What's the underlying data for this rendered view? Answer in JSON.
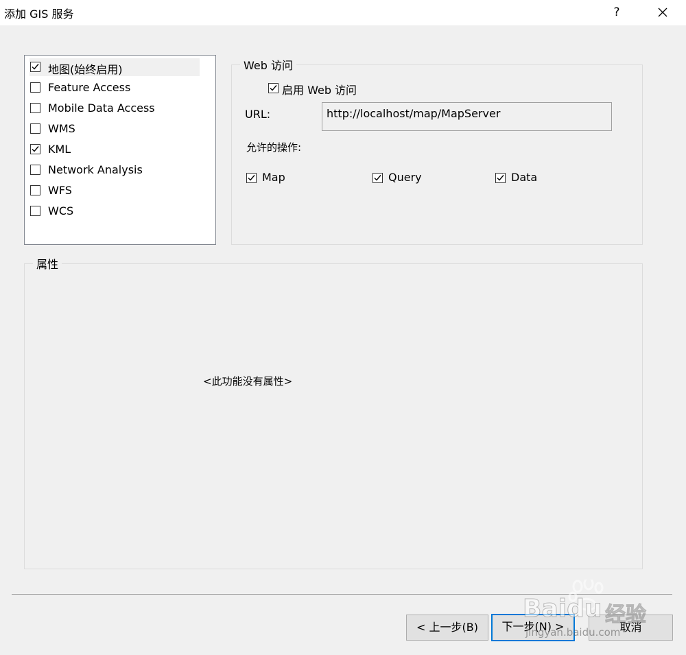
{
  "dialog": {
    "title": "添加 GIS 服务",
    "help_label": "?"
  },
  "services": [
    {
      "label": "地图(始终启用)",
      "checked": true,
      "selected": true
    },
    {
      "label": "Feature Access",
      "checked": false
    },
    {
      "label": "Mobile Data Access",
      "checked": false
    },
    {
      "label": "WMS",
      "checked": false
    },
    {
      "label": "KML",
      "checked": true
    },
    {
      "label": "Network Analysis",
      "checked": false
    },
    {
      "label": "WFS",
      "checked": false
    },
    {
      "label": "WCS",
      "checked": false
    }
  ],
  "web_access": {
    "group_title": "Web 访问",
    "enable_label": "启用 Web 访问",
    "enabled": true,
    "url_label": "URL:",
    "url_value": "http://localhost/map/MapServer",
    "operations_label": "允许的操作:",
    "operations": [
      {
        "label": "Map",
        "checked": true
      },
      {
        "label": "Query",
        "checked": true
      },
      {
        "label": "Data",
        "checked": true
      }
    ]
  },
  "properties": {
    "group_title": "属性",
    "empty_text": "<此功能没有属性>"
  },
  "buttons": {
    "back": "< 上一步(B)",
    "next": "下一步(N) >",
    "cancel": "取消"
  },
  "watermark": {
    "brand": "Baidu",
    "suffix": "经验",
    "url": "jingyan.baidu.com"
  }
}
